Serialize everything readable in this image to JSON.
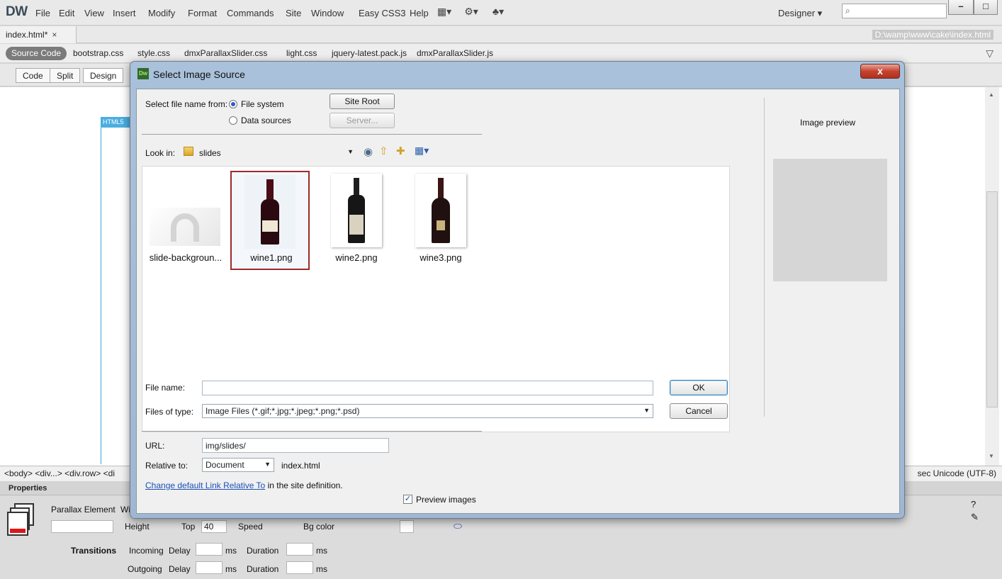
{
  "app": {
    "logo": "DW",
    "menu": [
      "File",
      "Edit",
      "View",
      "Insert",
      "Modify",
      "Format",
      "Commands",
      "Site",
      "Window",
      "Easy CSS3",
      "Help"
    ],
    "workspace_label": "Designer ▾",
    "search_placeholder": ""
  },
  "doc": {
    "tab_label": "index.html*",
    "tab_close": "×",
    "path": "D:\\wamp\\www\\cake\\index.html",
    "source_code": "Source Code",
    "related_files": [
      "bootstrap.css",
      "style.css",
      "dmxParallaxSlider.css",
      "light.css",
      "jquery-latest.pack.js",
      "dmxParallaxSlider.js"
    ]
  },
  "view": {
    "code": "Code",
    "split": "Split",
    "design": "Design"
  },
  "canvas": {
    "tag": "HTML5"
  },
  "status": {
    "breadcrumb": "<body> <div...> <div.row> <di",
    "right": "sec  Unicode (UTF-8)"
  },
  "properties": {
    "title": "Properties",
    "element_label": "Parallax Element",
    "w_label": "Wi",
    "height_label": "Height",
    "top_label": "Top",
    "top_value": "40",
    "speed_label": "Speed",
    "bgcolor_label": "Bg color",
    "transitions_label": "Transitions",
    "incoming_label": "Incoming",
    "outgoing_label": "Outgoing",
    "delay_label": "Delay",
    "ms": "ms",
    "duration_label": "Duration"
  },
  "dialog": {
    "title": "Select Image Source",
    "close": "x",
    "select_from_label": "Select file name from:",
    "opt_file_system": "File system",
    "opt_data_sources": "Data sources",
    "site_root": "Site Root",
    "server": "Server...",
    "look_in_label": "Look in:",
    "look_in_value": "slides",
    "files": [
      {
        "name": "slide-backgroun...",
        "selected": false
      },
      {
        "name": "wine1.png",
        "selected": true
      },
      {
        "name": "wine2.png",
        "selected": false
      },
      {
        "name": "wine3.png",
        "selected": false
      }
    ],
    "file_name_label": "File name:",
    "file_name_value": "",
    "ok": "OK",
    "files_of_type_label": "Files of type:",
    "files_of_type_value": "Image Files (*.gif;*.jpg;*.jpeg;*.png;*.psd)",
    "cancel": "Cancel",
    "url_label": "URL:",
    "url_value": "img/slides/",
    "relative_label": "Relative to:",
    "relative_value": "Document",
    "relative_file": "index.html",
    "change_link": "Change default Link Relative To",
    "change_link_suffix": " in the site definition.",
    "preview_images": "Preview images",
    "image_preview": "Image preview"
  }
}
